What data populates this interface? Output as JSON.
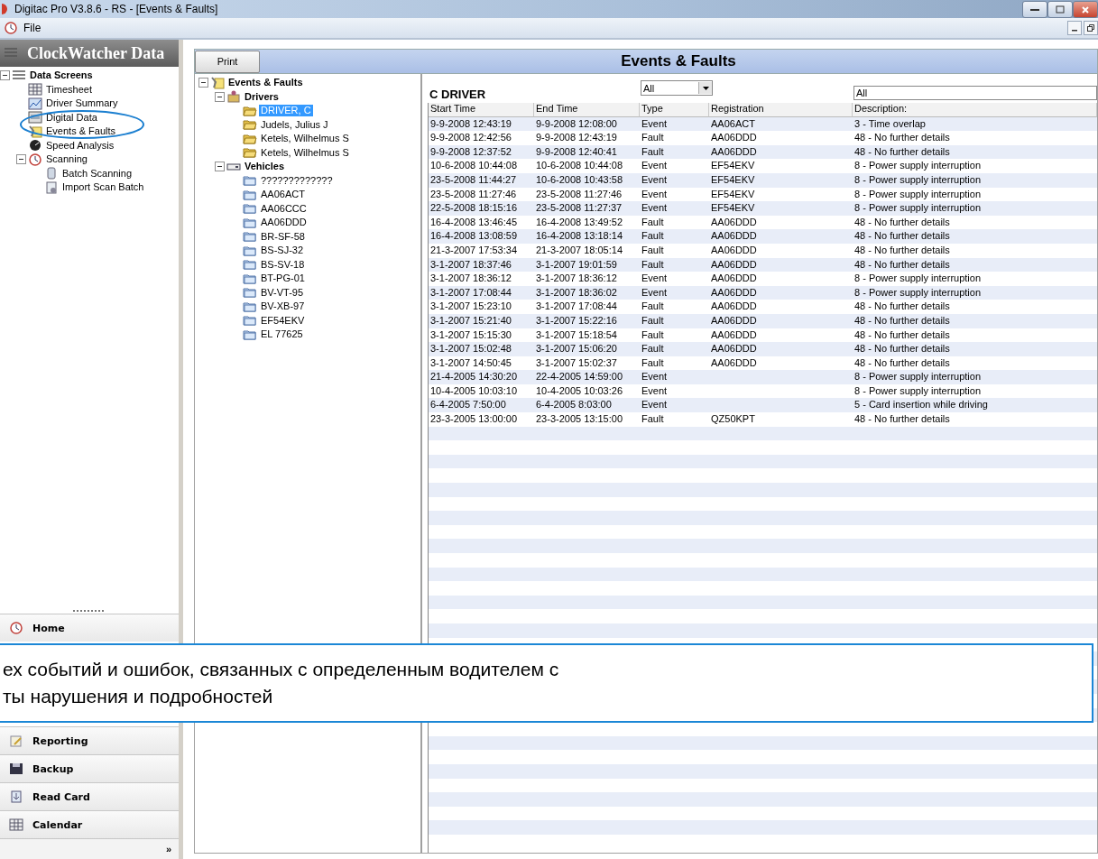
{
  "window": {
    "title": "Digitac Pro V3.8.6 - RS - [Events & Faults]"
  },
  "menu": [
    "File"
  ],
  "sidebar": {
    "header": "ClockWatcher Data",
    "tree": [
      {
        "label": "Data Screens",
        "kind": "list",
        "expanded": true,
        "selected": false,
        "children": [
          {
            "label": "Timesheet",
            "kind": "grid",
            "selected": false
          },
          {
            "label": "Driver Summary",
            "kind": "chart",
            "selected": false
          },
          {
            "label": "Digital Data",
            "kind": "digital",
            "selected": false
          },
          {
            "label": "Events & Faults",
            "kind": "wrench",
            "selected": false
          },
          {
            "label": "Speed Analysis",
            "kind": "gauge",
            "selected": false
          },
          {
            "label": "Scanning",
            "kind": "clock",
            "expanded": true,
            "selected": false,
            "children": [
              {
                "label": "Batch Scanning",
                "kind": "scanner",
                "selected": false
              },
              {
                "label": "Import Scan Batch",
                "kind": "import",
                "selected": false
              }
            ]
          }
        ]
      }
    ],
    "nav": [
      {
        "label": "Home",
        "kind": "clock"
      },
      {
        "label": "Reporting",
        "kind": "clipboard"
      },
      {
        "label": "Backup",
        "kind": "disk"
      },
      {
        "label": "Read Card",
        "kind": "card"
      },
      {
        "label": "Calendar",
        "kind": "grid"
      }
    ],
    "more": "»"
  },
  "content": {
    "print_button": "Print",
    "title": "Events & Faults",
    "tree": [
      {
        "label": "Events & Faults",
        "kind": "wrench",
        "expanded": true,
        "selected": false,
        "children": [
          {
            "label": "Drivers",
            "kind": "drivers",
            "expanded": true,
            "selected": false,
            "children": [
              {
                "label": "DRIVER, C",
                "kind": "folder-open",
                "selected": true
              },
              {
                "label": "Judels, Julius J",
                "kind": "folder-open",
                "selected": false
              },
              {
                "label": "Ketels, Wilhelmus S",
                "kind": "folder-open",
                "selected": false
              },
              {
                "label": "Ketels, Wilhelmus S",
                "kind": "folder-open",
                "selected": false
              }
            ]
          },
          {
            "label": "Vehicles",
            "kind": "vehicle",
            "expanded": true,
            "selected": false,
            "children": [
              {
                "label": "?????????????",
                "kind": "folder",
                "selected": false
              },
              {
                "label": "AA06ACT",
                "kind": "folder",
                "selected": false
              },
              {
                "label": "AA06CCC",
                "kind": "folder",
                "selected": false
              },
              {
                "label": "AA06DDD",
                "kind": "folder",
                "selected": false
              },
              {
                "label": "BR-SF-58",
                "kind": "folder",
                "selected": false
              },
              {
                "label": "BS-SJ-32",
                "kind": "folder",
                "selected": false
              },
              {
                "label": "BS-SV-18",
                "kind": "folder",
                "selected": false
              },
              {
                "label": "BT-PG-01",
                "kind": "folder",
                "selected": false
              },
              {
                "label": "BV-VT-95",
                "kind": "folder",
                "selected": false
              },
              {
                "label": "BV-XB-97",
                "kind": "folder",
                "selected": false
              },
              {
                "label": "EF54EKV",
                "kind": "folder",
                "selected": false
              },
              {
                "label": "EL 77625",
                "kind": "folder",
                "selected": false
              }
            ]
          }
        ]
      }
    ],
    "driver_name": "C DRIVER",
    "type_filter": "All",
    "description_filter": "All",
    "table": {
      "columns": [
        "Start Time",
        "End Time",
        "Type",
        "Registration",
        "Description:"
      ],
      "rows": [
        [
          "9-9-2008 12:43:19",
          "9-9-2008 12:08:00",
          "Event",
          "AA06ACT",
          "3 - Time overlap"
        ],
        [
          "9-9-2008 12:42:56",
          "9-9-2008 12:43:19",
          "Fault",
          "AA06DDD",
          "48 - No further details"
        ],
        [
          "9-9-2008 12:37:52",
          "9-9-2008 12:40:41",
          "Fault",
          "AA06DDD",
          "48 - No further details"
        ],
        [
          "10-6-2008 10:44:08",
          "10-6-2008 10:44:08",
          "Event",
          "EF54EKV",
          "8 - Power supply interruption"
        ],
        [
          "23-5-2008 11:44:27",
          "10-6-2008 10:43:58",
          "Event",
          "EF54EKV",
          "8 - Power supply interruption"
        ],
        [
          "23-5-2008 11:27:46",
          "23-5-2008 11:27:46",
          "Event",
          "EF54EKV",
          "8 - Power supply interruption"
        ],
        [
          "22-5-2008 18:15:16",
          "23-5-2008 11:27:37",
          "Event",
          "EF54EKV",
          "8 - Power supply interruption"
        ],
        [
          "16-4-2008 13:46:45",
          "16-4-2008 13:49:52",
          "Fault",
          "AA06DDD",
          "48 - No further details"
        ],
        [
          "16-4-2008 13:08:59",
          "16-4-2008 13:18:14",
          "Fault",
          "AA06DDD",
          "48 - No further details"
        ],
        [
          "21-3-2007 17:53:34",
          "21-3-2007 18:05:14",
          "Fault",
          "AA06DDD",
          "48 - No further details"
        ],
        [
          "3-1-2007 18:37:46",
          "3-1-2007 19:01:59",
          "Fault",
          "AA06DDD",
          "48 - No further details"
        ],
        [
          "3-1-2007 18:36:12",
          "3-1-2007 18:36:12",
          "Event",
          "AA06DDD",
          "8 - Power supply interruption"
        ],
        [
          "3-1-2007 17:08:44",
          "3-1-2007 18:36:02",
          "Event",
          "AA06DDD",
          "8 - Power supply interruption"
        ],
        [
          "3-1-2007 15:23:10",
          "3-1-2007 17:08:44",
          "Fault",
          "AA06DDD",
          "48 - No further details"
        ],
        [
          "3-1-2007 15:21:40",
          "3-1-2007 15:22:16",
          "Fault",
          "AA06DDD",
          "48 - No further details"
        ],
        [
          "3-1-2007 15:15:30",
          "3-1-2007 15:18:54",
          "Fault",
          "AA06DDD",
          "48 - No further details"
        ],
        [
          "3-1-2007 15:02:48",
          "3-1-2007 15:06:20",
          "Fault",
          "AA06DDD",
          "48 - No further details"
        ],
        [
          "3-1-2007 14:50:45",
          "3-1-2007 15:02:37",
          "Fault",
          "AA06DDD",
          "48 - No further details"
        ],
        [
          "21-4-2005 14:30:20",
          "22-4-2005 14:59:00",
          "Event",
          null,
          "8 - Power supply interruption"
        ],
        [
          "10-4-2005 10:03:10",
          "10-4-2005 10:03:26",
          "Event",
          null,
          "8 - Power supply interruption"
        ],
        [
          "6-4-2005 7:50:00",
          "6-4-2005 8:03:00",
          "Event",
          null,
          "5 - Card insertion while driving"
        ],
        [
          "23-3-2005 13:00:00",
          "23-3-2005 13:15:00",
          "Fault",
          "QZ50KPT",
          "48 - No further details"
        ]
      ]
    }
  },
  "callout": {
    "lines": [
      "ех событий и ошибок, связанных с определенным водителем с",
      "ты нарушения и подробностей"
    ]
  }
}
